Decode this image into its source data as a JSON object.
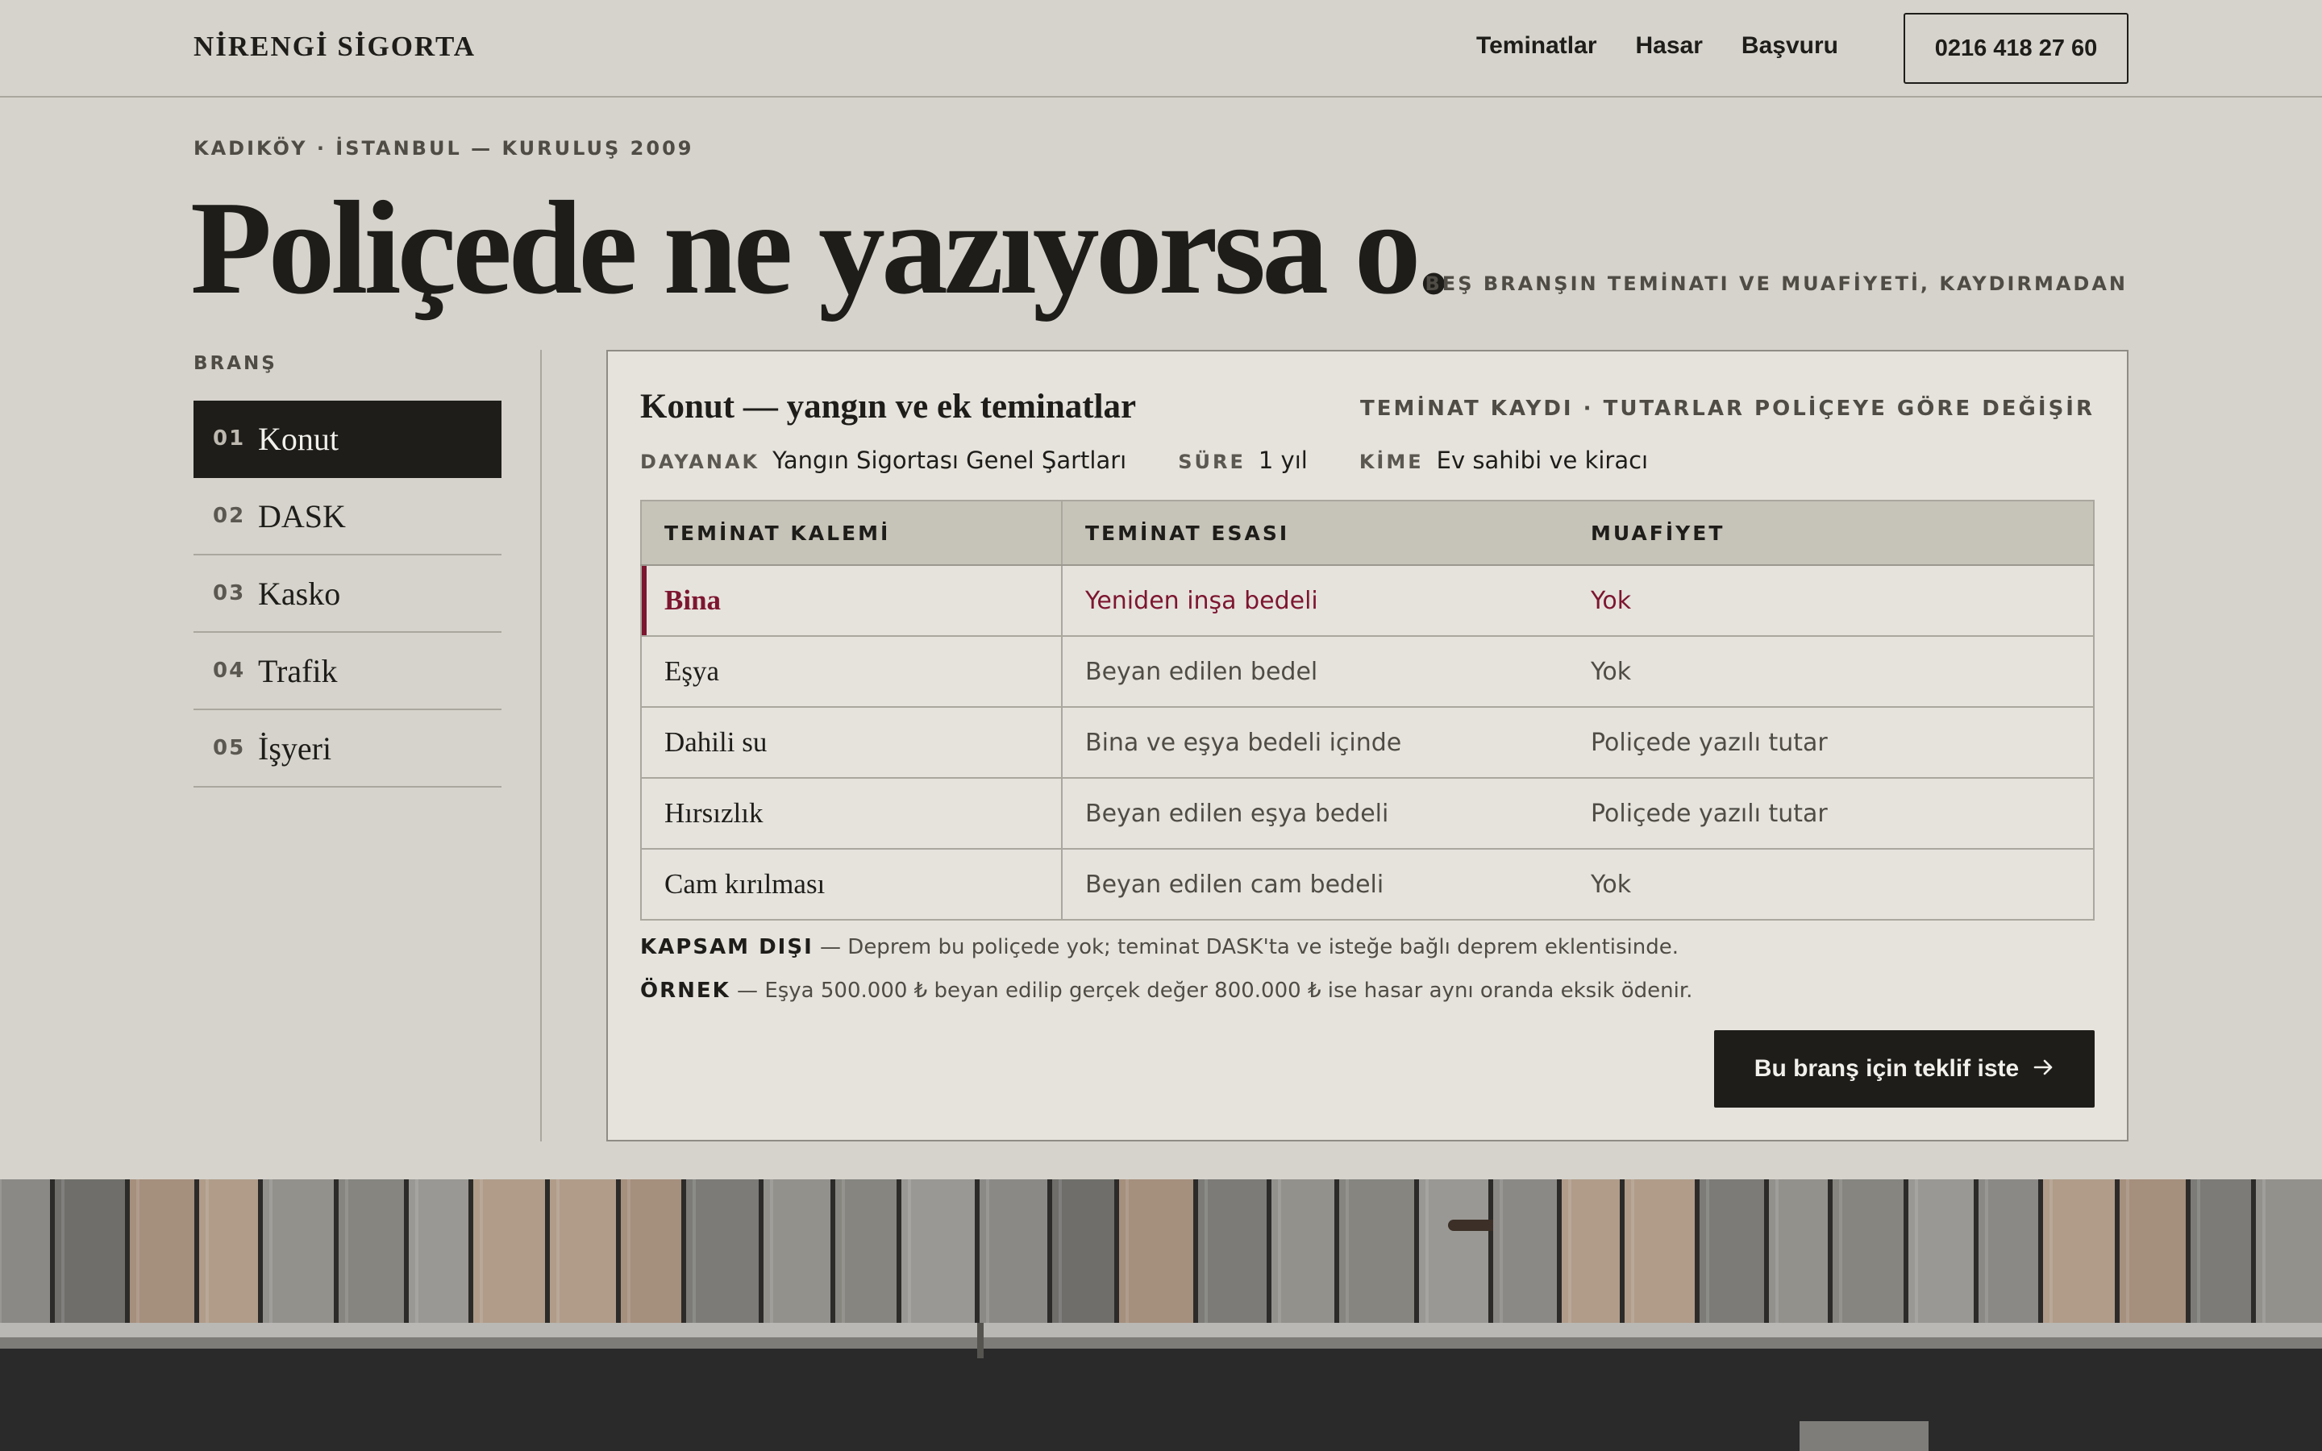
{
  "header": {
    "brand": "NİRENGİ SİGORTA",
    "nav": [
      "Teminatlar",
      "Hasar",
      "Başvuru"
    ],
    "phone": "0216 418 27 60"
  },
  "hero": {
    "eyebrow": "KADIKÖY · İSTANBUL — KURULUŞ 2009",
    "title": "Poliçede ne yazıyorsa o.",
    "note": "BEŞ BRANŞIN TEMİNATI VE MUAFİYETİ, KAYDIRMADAN"
  },
  "sidebar": {
    "label": "BRANŞ",
    "items": [
      {
        "num": "01",
        "label": "Konut",
        "active": true
      },
      {
        "num": "02",
        "label": "DASK"
      },
      {
        "num": "03",
        "label": "Kasko"
      },
      {
        "num": "04",
        "label": "Trafik"
      },
      {
        "num": "05",
        "label": "İşyeri"
      }
    ]
  },
  "panel": {
    "title": "Konut — yangın ve ek teminatlar",
    "note": "TEMİNAT KAYDI · TUTARLAR POLİÇEYE GÖRE DEĞİŞİR",
    "meta": {
      "basis_key": "DAYANAK",
      "basis_value": "Yangın Sigortası Genel Şartları",
      "term_key": "SÜRE",
      "term_value": "1 yıl",
      "who_key": "KİME",
      "who_value": "Ev sahibi ve kiracı"
    },
    "columns": [
      "TEMİNAT KALEMİ",
      "TEMİNAT ESASI",
      "MUAFİYET"
    ],
    "rows": [
      {
        "item": "Bina",
        "basis": "Yeniden inşa bedeli",
        "deductible": "Yok"
      },
      {
        "item": "Eşya",
        "basis": "Beyan edilen bedel",
        "deductible": "Yok"
      },
      {
        "item": "Dahili su",
        "basis": "Bina ve eşya bedeli içinde",
        "deductible": "Poliçede yazılı tutar"
      },
      {
        "item": "Hırsızlık",
        "basis": "Beyan edilen eşya bedeli",
        "deductible": "Poliçede yazılı tutar"
      },
      {
        "item": "Cam kırılması",
        "basis": "Beyan edilen cam bedeli",
        "deductible": "Yok"
      }
    ],
    "exclusion_key": "KAPSAM DIŞI",
    "exclusion_text": " — Deprem bu poliçede yok; teminat DASK'ta ve isteğe bağlı deprem eklentisinde.",
    "example_key": "ÖRNEK",
    "example_text": " — Eşya 500.000 ₺ beyan edilip gerçek değer 800.000 ₺ ise hasar aynı oranda eksik ödenir.",
    "cta": "Bu branş için teklif iste",
    "cta_icon": "arrow-right-icon"
  },
  "colors": {
    "background": "#d6d3cc",
    "ink": "#1e1d19",
    "accent": "#7d1630",
    "panel": "#e6e3dd",
    "table_header": "#c6c3b9"
  }
}
